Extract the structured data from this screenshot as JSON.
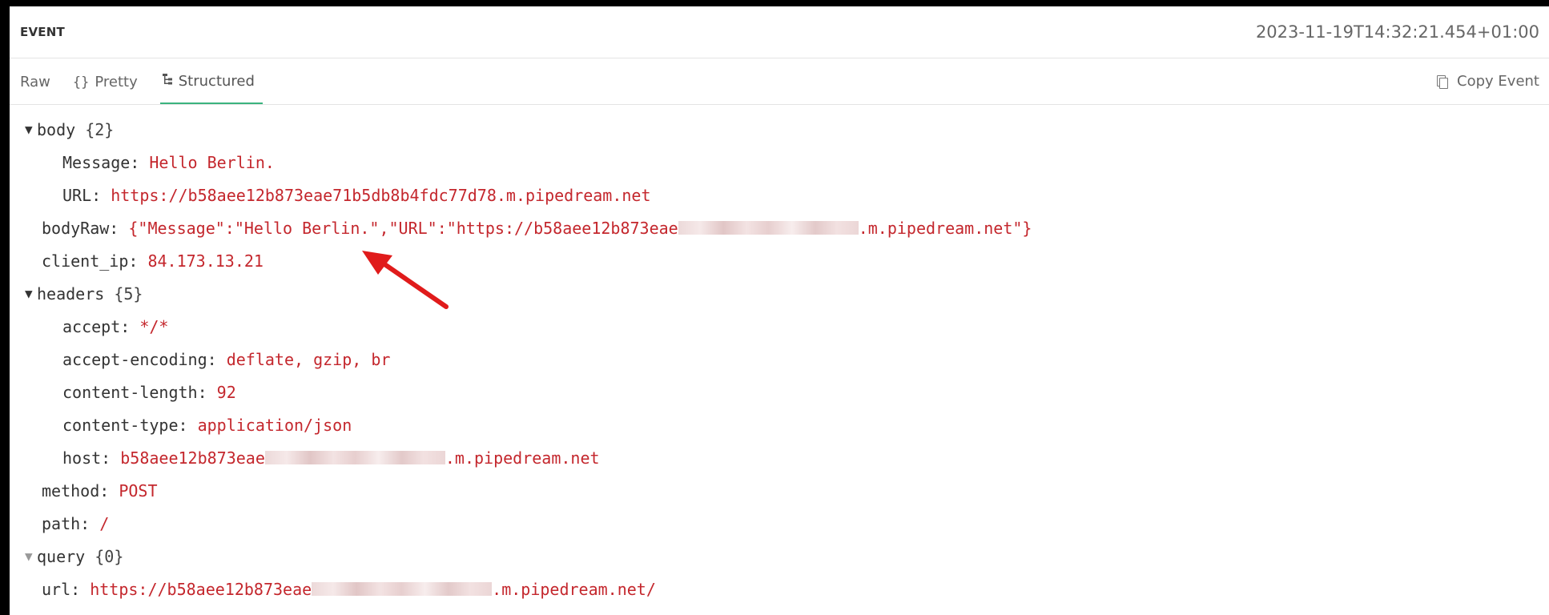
{
  "header": {
    "title": "EVENT",
    "timestamp": "2023-11-19T14:32:21.454+01:00"
  },
  "tabs": [
    {
      "label": "Raw",
      "icon": "",
      "active": false
    },
    {
      "label": "Pretty",
      "icon": "{}",
      "active": false
    },
    {
      "label": "Structured",
      "icon": "tree-icon",
      "active": true
    }
  ],
  "copy_event": {
    "label": "Copy Event",
    "icon": "copy-icon"
  },
  "tree": {
    "body": {
      "key": "body",
      "count": "{2}"
    },
    "message": {
      "key": "Message:",
      "value": "Hello Berlin."
    },
    "body_url": {
      "key": "URL:",
      "value": "https://b58aee12b873eae71b5db8b4fdc77d78.m.pipedream.net"
    },
    "body_raw": {
      "key": "bodyRaw:",
      "value_start": "{\"Message\":\"Hello Berlin.\",\"URL\":\"https://b58aee12b873eae",
      "value_end": ".m.pipedream.net\"}"
    },
    "client_ip": {
      "key": "client_ip:",
      "value": "84.173.13.21"
    },
    "headers": {
      "key": "headers",
      "count": "{5}"
    },
    "accept": {
      "key": "accept:",
      "value": "*/*"
    },
    "accept_encoding": {
      "key": "accept-encoding:",
      "value": "deflate, gzip, br"
    },
    "content_length": {
      "key": "content-length:",
      "value": "92"
    },
    "content_type": {
      "key": "content-type:",
      "value": "application/json"
    },
    "host": {
      "key": "host:",
      "value_start": "b58aee12b873eae",
      "value_end": ".m.pipedream.net"
    },
    "method": {
      "key": "method:",
      "value": "POST"
    },
    "path": {
      "key": "path:",
      "value": "/"
    },
    "query": {
      "key": "query",
      "count": "{0}"
    },
    "url": {
      "key": "url:",
      "value_start": "https://b58aee12b873eae",
      "value_end": ".m.pipedream.net/"
    }
  },
  "colors": {
    "key": "#333333",
    "value": "#c4272d",
    "accent": "#3bb37e",
    "annotation_arrow": "#e01b1b"
  }
}
